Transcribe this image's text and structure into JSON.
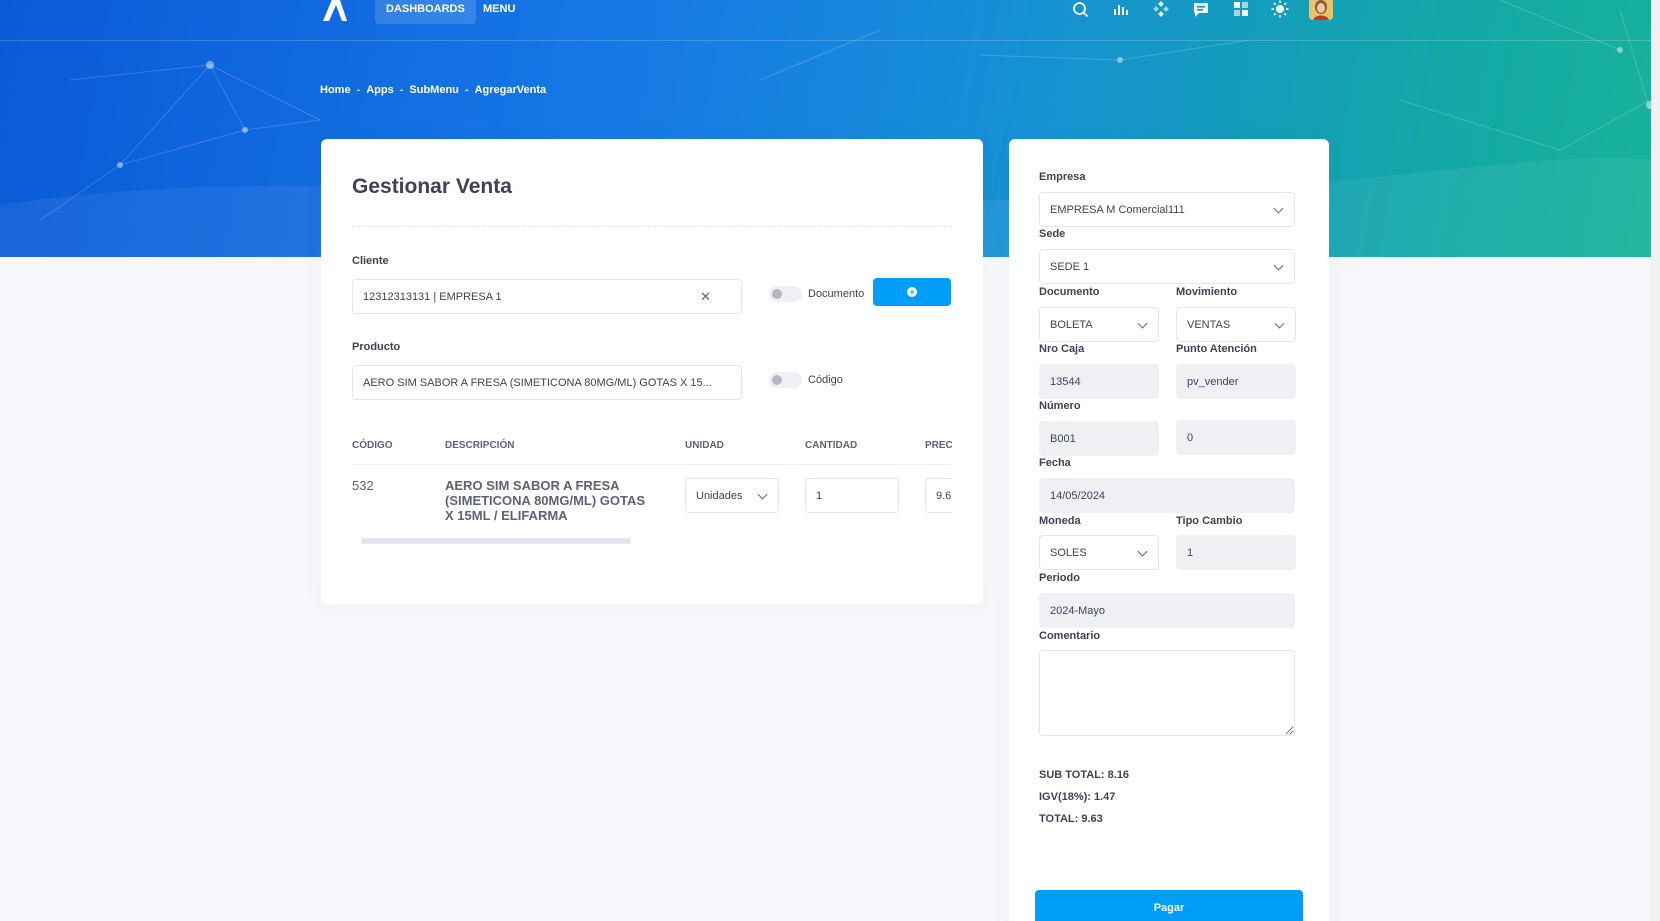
{
  "nav": {
    "dashboards": "DASHBOARDS",
    "menu": "MENU",
    "icons": [
      "search-icon",
      "chart-icon",
      "apps-icon",
      "chat-icon",
      "grid-icon",
      "theme-icon"
    ]
  },
  "breadcrumb": [
    "Home",
    "Apps",
    "SubMenu",
    "AgregarVenta"
  ],
  "main": {
    "title": "Gestionar Venta",
    "cliente": {
      "label": "Cliente",
      "value": "12312313131 | EMPRESA 1",
      "toggle_label": "Documento"
    },
    "producto": {
      "label": "Producto",
      "value": "AERO SIM SABOR A FRESA (SIMETICONA 80MG/ML) GOTAS X 15...",
      "toggle_label": "Código"
    },
    "table": {
      "headers": [
        "CÓDIGO",
        "DESCRIPCIÓN",
        "UNIDAD",
        "CANTIDAD",
        "PREC"
      ],
      "rows": [
        {
          "codigo": "532",
          "descripcion": "AERO SIM SABOR A FRESA (SIMETICONA 80MG/ML) GOTAS X 15ML / ELIFARMA",
          "unidad": "Unidades",
          "cantidad": "1",
          "precio": "9.6"
        }
      ]
    }
  },
  "side": {
    "empresa": {
      "label": "Empresa",
      "value": "EMPRESA M Comercial111"
    },
    "sede": {
      "label": "Sede",
      "value": "SEDE 1"
    },
    "documento": {
      "label": "Documento",
      "value": "BOLETA"
    },
    "movimiento": {
      "label": "Movimiento",
      "value": "VENTAS"
    },
    "nro_caja": {
      "label": "Nro Caja",
      "value": "13544"
    },
    "punto_atencion": {
      "label": "Punto Atención",
      "value": "pv_vender"
    },
    "numero": {
      "label": "Número",
      "serie": "B001",
      "correlativo": "0"
    },
    "fecha": {
      "label": "Fecha",
      "value": "14/05/2024"
    },
    "moneda": {
      "label": "Moneda",
      "value": "SOLES"
    },
    "tipo_cambio": {
      "label": "Tipo Cambio",
      "value": "1"
    },
    "periodo": {
      "label": "Periodo",
      "value": "2024-Mayo"
    },
    "comentario": {
      "label": "Comentario",
      "value": ""
    },
    "sub_total": "SUB TOTAL: 8.16",
    "igv": "IGV(18%): 1.47",
    "total": "TOTAL: 9.63",
    "pagar": "Pagar"
  },
  "colors": {
    "primary": "#009ef7",
    "hero_start": "#0a5ad6",
    "hero_end": "#18b39a"
  }
}
